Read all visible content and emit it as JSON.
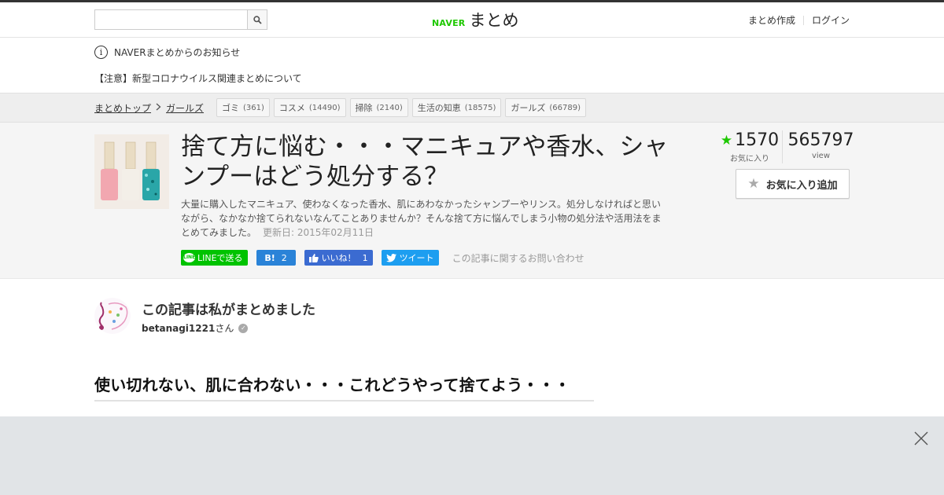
{
  "header": {
    "search_placeholder": "",
    "logo_brand": "NAVER",
    "logo_title": "まとめ",
    "links": [
      "まとめ作成",
      "ログイン"
    ]
  },
  "notice": {
    "title": "NAVERまとめからのお知らせ",
    "link": "【注意】新型コロナウイルス関連まとめについて"
  },
  "breadcrumb": {
    "items": [
      "まとめトップ",
      "ガールズ"
    ]
  },
  "tags": [
    {
      "label": "ゴミ",
      "count": "(361)"
    },
    {
      "label": "コスメ",
      "count": "(14490)"
    },
    {
      "label": "掃除",
      "count": "(2140)"
    },
    {
      "label": "生活の知恵",
      "count": "(18575)"
    },
    {
      "label": "ガールズ",
      "count": "(66789)"
    }
  ],
  "article": {
    "title": "捨て方に悩む・・・マニキュアや香水、シャンプーはどう処分する？",
    "description": "大量に購入したマニキュア、使わなくなった香水、肌にあわなかったシャンプーやリンス。処分しなければと思いながら、なかなか捨てられないなんてことありませんか？そんな捨て方に悩んでしまう小物の処分法や活用法をまとめてみました。",
    "updated": "更新日: 2015年02月11日",
    "favorites": "1570",
    "favorites_label": "お気に入り",
    "views": "565797",
    "views_label": "view",
    "fav_button": "お気に入り追加"
  },
  "share": {
    "line_icon": "LINE",
    "line": "LINEで送る",
    "hatena_mark": "B!",
    "hatena_count": "2",
    "fb_label": "いいね！",
    "fb_count": "1",
    "tweet": "ツイート",
    "inquiry": "この記事に関するお問い合わせ"
  },
  "author": {
    "heading": "この記事は私がまとめました",
    "name": "betanagi1221",
    "suffix": "さん"
  },
  "section_heading": "使い切れない、肌に合わない・・・これどうやって捨てよう・・・",
  "colors": {
    "naver_green": "#1ec800",
    "line_green": "#00c300",
    "hatena_blue": "#2a83d8",
    "facebook_blue": "#3b6bd1",
    "twitter_blue": "#1d9ef0",
    "overlay_gray": "#e1e4e7"
  }
}
